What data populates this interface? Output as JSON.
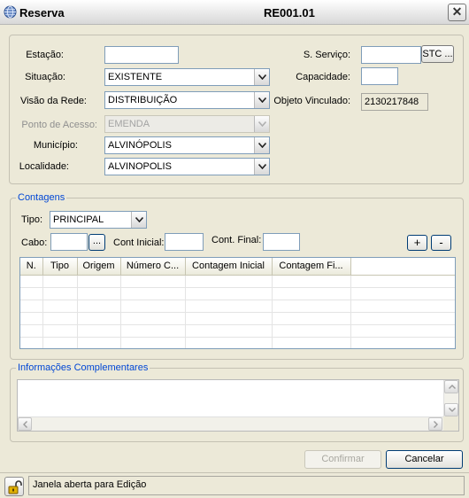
{
  "window": {
    "title": "Reserva",
    "code": "RE001.01",
    "close_label": "✕",
    "icon": "globe-icon"
  },
  "form": {
    "estacao": {
      "label": "Estação:",
      "value": ""
    },
    "situacao": {
      "label": "Situação:",
      "value": "EXISTENTE"
    },
    "visao_rede": {
      "label": "Visão da Rede:",
      "value": "DISTRIBUIÇÃO"
    },
    "ponto_acesso": {
      "label": "Ponto de Acesso:",
      "value": "EMENDA"
    },
    "municipio": {
      "label": "Município:",
      "value": "ALVINÓPOLIS"
    },
    "localidade": {
      "label": "Localidade:",
      "value": "ALVINOPOLIS"
    },
    "servico": {
      "label": "S. Serviço:",
      "value": "",
      "button": "STC ..."
    },
    "capacidade": {
      "label": "Capacidade:",
      "value": ""
    },
    "objeto": {
      "label": "Objeto Vinculado:",
      "value": "2130217848"
    }
  },
  "contagens": {
    "group_title": "Contagens",
    "tipo": {
      "label": "Tipo:",
      "value": "PRINCIPAL"
    },
    "cabo": {
      "label": "Cabo:",
      "value": "",
      "button": "..."
    },
    "cont_inicial": {
      "label": "Cont Inicial:",
      "value": ""
    },
    "cont_final": {
      "label": "Cont. Final:",
      "value": ""
    },
    "add_label": "+",
    "remove_label": "-",
    "columns": [
      "N.",
      "Tipo",
      "Origem",
      "Número C...",
      "Contagem Inicial",
      "Contagem Fi..."
    ]
  },
  "info": {
    "group_title": "Informações Complementares",
    "text": ""
  },
  "buttons": {
    "confirm": "Confirmar",
    "cancel": "Cancelar"
  },
  "status": {
    "text": "Janela aberta para Edição",
    "icon": "lock-icon"
  }
}
